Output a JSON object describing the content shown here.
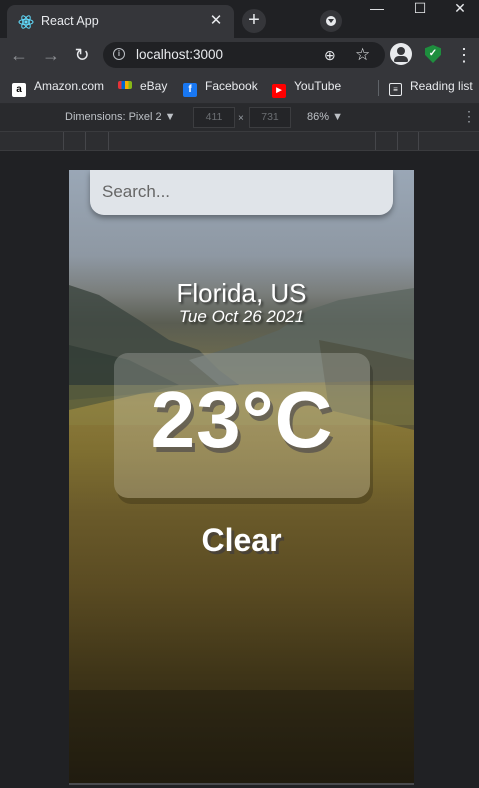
{
  "browser": {
    "tab": {
      "title": "React App"
    },
    "omnibox": {
      "url": "localhost:3000"
    },
    "bookmarks": [
      {
        "label": "Amazon.com",
        "icon": "amazon-icon"
      },
      {
        "label": "eBay",
        "icon": "ebay-icon"
      },
      {
        "label": "Facebook",
        "icon": "facebook-icon"
      },
      {
        "label": "YouTube",
        "icon": "youtube-icon"
      }
    ],
    "reading_list": "Reading list"
  },
  "devtools": {
    "dimensions_label": "Dimensions: Pixel 2 ▼",
    "width": "411",
    "height": "731",
    "zoom": "86% ▼"
  },
  "app": {
    "search": {
      "placeholder": "Search..."
    },
    "location": "Florida, US",
    "date": "Tue Oct 26 2021",
    "temperature": "23°C",
    "condition": "Clear"
  },
  "colors": {
    "browser_bg": "#202124",
    "toolbar_bg": "#35363a",
    "shield_green": "#1e8e3e",
    "youtube_red": "#ff0000",
    "facebook_blue": "#1877f2"
  }
}
